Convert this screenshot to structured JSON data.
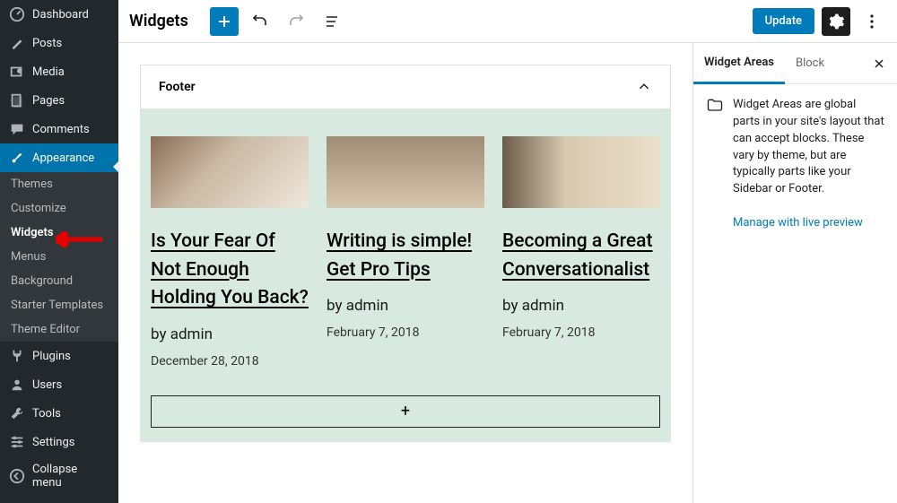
{
  "sidebar": {
    "items": [
      {
        "label": "Dashboard"
      },
      {
        "label": "Posts"
      },
      {
        "label": "Media"
      },
      {
        "label": "Pages"
      },
      {
        "label": "Comments"
      },
      {
        "label": "Appearance"
      },
      {
        "label": "Plugins"
      },
      {
        "label": "Users"
      },
      {
        "label": "Tools"
      },
      {
        "label": "Settings"
      },
      {
        "label": "Collapse menu"
      }
    ],
    "appearance_sub": [
      {
        "label": "Themes"
      },
      {
        "label": "Customize"
      },
      {
        "label": "Widgets"
      },
      {
        "label": "Menus"
      },
      {
        "label": "Background"
      },
      {
        "label": "Starter Templates"
      },
      {
        "label": "Theme Editor"
      }
    ]
  },
  "topbar": {
    "title": "Widgets",
    "update": "Update"
  },
  "canvas": {
    "panel_title": "Footer",
    "posts": [
      {
        "title": "Is Your Fear Of Not Enough Holding You Back?",
        "author": "by admin",
        "date": "December 28, 2018"
      },
      {
        "title": "Writing is simple! Get Pro Tips",
        "author": "by admin",
        "date": "February 7, 2018"
      },
      {
        "title": "Becoming a Great Conversationalist",
        "author": "by admin",
        "date": "February 7, 2018"
      }
    ],
    "add_block_label": "+"
  },
  "inspector": {
    "tab_widget_areas": "Widget Areas",
    "tab_block": "Block",
    "description": "Widget Areas are global parts in your site's layout that can accept blocks. These vary by theme, but are typically parts like your Sidebar or Footer.",
    "manage_link": "Manage with live preview"
  }
}
